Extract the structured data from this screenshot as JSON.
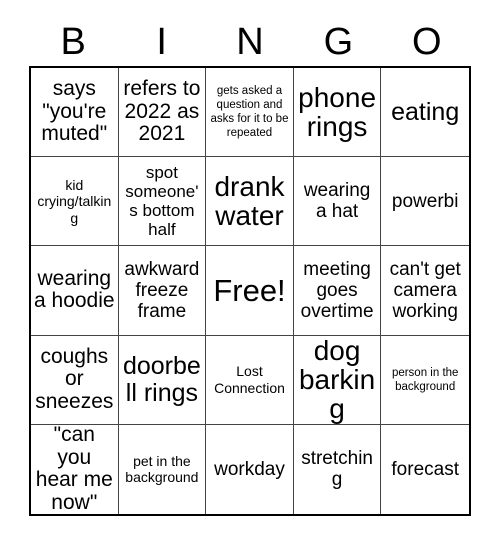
{
  "card": {
    "title_letters": [
      "B",
      "I",
      "N",
      "G",
      "O"
    ],
    "colors": {
      "text": "#000000",
      "outer_border": "#000000",
      "inner_border": "#444444",
      "background": "#ffffff"
    },
    "rows": [
      [
        {
          "text": "says \"you're muted\"",
          "size": "l"
        },
        {
          "text": "refers to 2022 as 2021",
          "size": "l"
        },
        {
          "text": "gets asked a question and asks for it to be repeated",
          "size": "xs"
        },
        {
          "text": "phone rings",
          "size": "xxl"
        },
        {
          "text": "eating",
          "size": "xl"
        }
      ],
      [
        {
          "text": "kid crying/talking",
          "size": "s"
        },
        {
          "text": "spot someone's bottom half",
          "size": "m"
        },
        {
          "text": "drank water",
          "size": "xxl"
        },
        {
          "text": "wearing a hat",
          "size": "ml"
        },
        {
          "text": "powerbi",
          "size": "ml"
        }
      ],
      [
        {
          "text": "wearing a hoodie",
          "size": "l"
        },
        {
          "text": "awkward freeze frame",
          "size": "ml"
        },
        {
          "text": "Free!",
          "size": "free"
        },
        {
          "text": "meeting goes overtime",
          "size": "ml"
        },
        {
          "text": "can't get camera working",
          "size": "ml"
        }
      ],
      [
        {
          "text": "coughs or sneezes",
          "size": "l"
        },
        {
          "text": "doorbell rings",
          "size": "xl"
        },
        {
          "text": "Lost Connection",
          "size": "s"
        },
        {
          "text": "dog barking",
          "size": "xxl"
        },
        {
          "text": "person in the background",
          "size": "xs"
        }
      ],
      [
        {
          "text": "\"can you hear me now\"",
          "size": "l"
        },
        {
          "text": "pet in the background",
          "size": "s"
        },
        {
          "text": "workday",
          "size": "ml"
        },
        {
          "text": "stretching",
          "size": "ml"
        },
        {
          "text": "forecast",
          "size": "ml"
        }
      ]
    ]
  }
}
